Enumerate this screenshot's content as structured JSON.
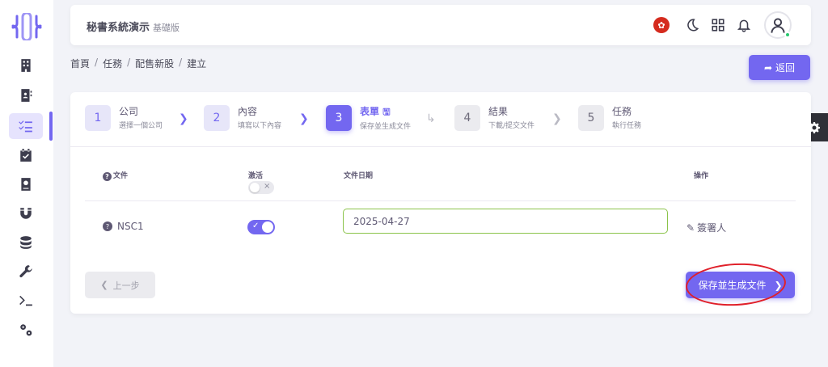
{
  "header": {
    "title": "秘書系統演示",
    "edition": "基礎版"
  },
  "breadcrumb": [
    "首頁",
    "任務",
    "配售新股",
    "建立"
  ],
  "back_label": "返回",
  "steps": [
    {
      "num": "1",
      "title": "公司",
      "sub": "選擇一個公司"
    },
    {
      "num": "2",
      "title": "內容",
      "sub": "填寫以下內容"
    },
    {
      "num": "3",
      "title": "表單",
      "sub": "保存並生成文件"
    },
    {
      "num": "4",
      "title": "結果",
      "sub": "下載/提交文件"
    },
    {
      "num": "5",
      "title": "任務",
      "sub": "執行任務"
    }
  ],
  "table": {
    "col_file": "文件",
    "col_active": "激活",
    "col_date": "文件日期",
    "col_action": "操作",
    "row": {
      "name": "NSC1",
      "active": true,
      "date": "2025-04-27",
      "action": "簽署人"
    }
  },
  "prev_label": "上一步",
  "next_label": "保存並生成文件",
  "colors": {
    "accent": "#7367f0",
    "annotation": "#e0202a",
    "input_border": "#8bc34a"
  }
}
